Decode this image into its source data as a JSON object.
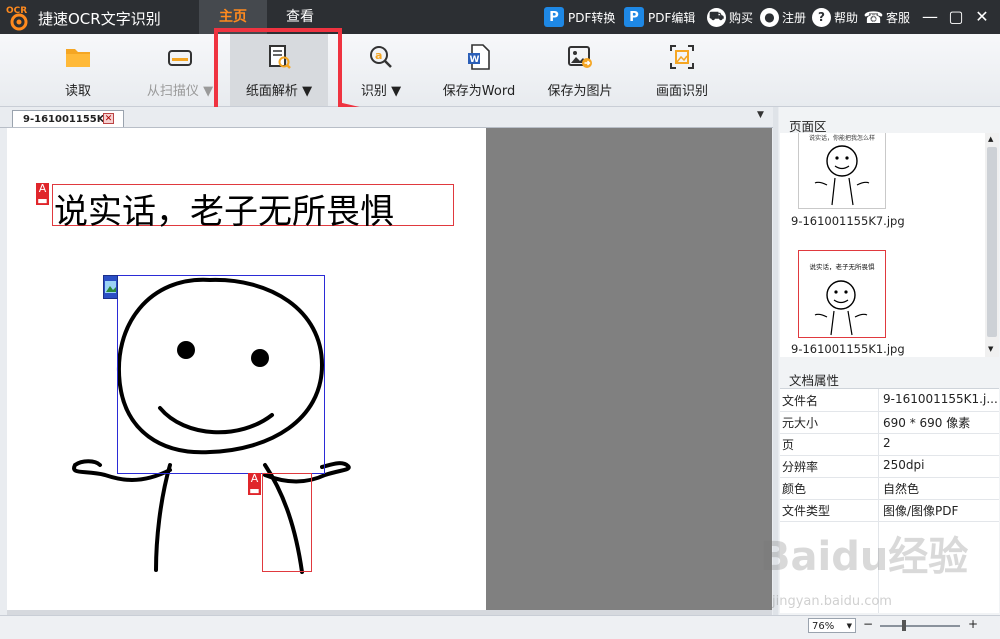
{
  "app": {
    "title": "捷速OCR文字识别",
    "logo_text": "OCR"
  },
  "main_tabs": [
    {
      "label": "主页"
    },
    {
      "label": "查看"
    }
  ],
  "top_links": {
    "pdf_convert": "PDF转换",
    "pdf_edit": "PDF编辑",
    "buy": "购买",
    "register": "注册",
    "help": "帮助",
    "service": "客服"
  },
  "ribbon": {
    "read": "读取",
    "scanner": "从扫描仪",
    "parse": "纸面解析",
    "recognize": "识别",
    "save_word": "保存为Word",
    "save_image": "保存为图片",
    "screen_recognize": "画面识别"
  },
  "document": {
    "tab_name": "9-161001155K1",
    "headline": "说实话，老子无所畏惧",
    "tag_letter": "A"
  },
  "right_panel": {
    "pages_title": "页面区",
    "thumbnails": [
      {
        "caption": "9-161001155K7.jpg",
        "text": "说实话，你能把我怎么样"
      },
      {
        "caption": "9-161001155K1.jpg",
        "text": "说实话，老子无所畏惧"
      }
    ],
    "props_title": "文档属性",
    "props": [
      {
        "key": "文件名",
        "value": "9-161001155K1.j..."
      },
      {
        "key": "元大小",
        "value": "690 * 690 像素"
      },
      {
        "key": "页",
        "value": "2"
      },
      {
        "key": "分辨率",
        "value": "250dpi"
      },
      {
        "key": "颜色",
        "value": "自然色"
      },
      {
        "key": "文件类型",
        "value": "图像/图像PDF"
      }
    ]
  },
  "status": {
    "zoom": "76%"
  },
  "watermark": {
    "brand": "Baidu经验",
    "url": "jingyan.baidu.com"
  },
  "colors": {
    "accent": "#ff8a1e",
    "highlight": "#ef3340",
    "titlebar": "#2c2f33",
    "pdf_blue": "#1e88e5"
  }
}
